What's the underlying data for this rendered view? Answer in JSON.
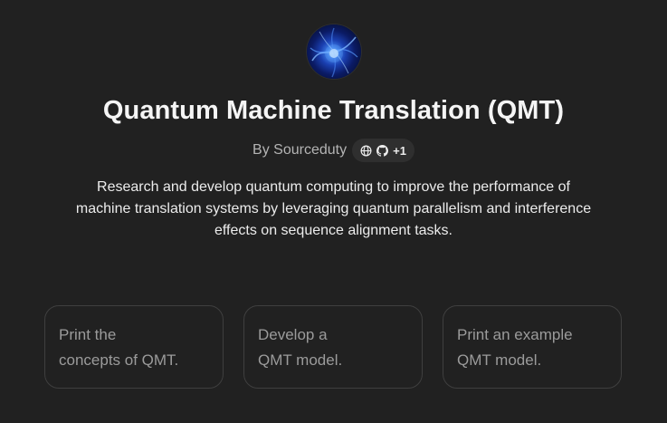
{
  "gpt": {
    "title": "Quantum Machine Translation (QMT)",
    "by_label": "By Sourceduty",
    "links": {
      "icons": [
        "globe-icon",
        "github-icon"
      ],
      "more_count": "+1"
    },
    "description": "Research and develop quantum computing to improve the performance of machine translation systems by leveraging quantum parallelism and interference effects on sequence alignment tasks."
  },
  "conversation_starters": [
    {
      "line1": "Print the",
      "line2": "concepts of QMT."
    },
    {
      "line1": "Develop a",
      "line2": "QMT model."
    },
    {
      "line1": "Print an example",
      "line2": "QMT model."
    }
  ],
  "colors": {
    "background": "#212121",
    "text_primary": "#ececec",
    "text_secondary": "#b4b4b4",
    "card_border": "#3f3f3f",
    "card_text": "#9b9b9b",
    "pill_bg": "#2f2f2f"
  }
}
